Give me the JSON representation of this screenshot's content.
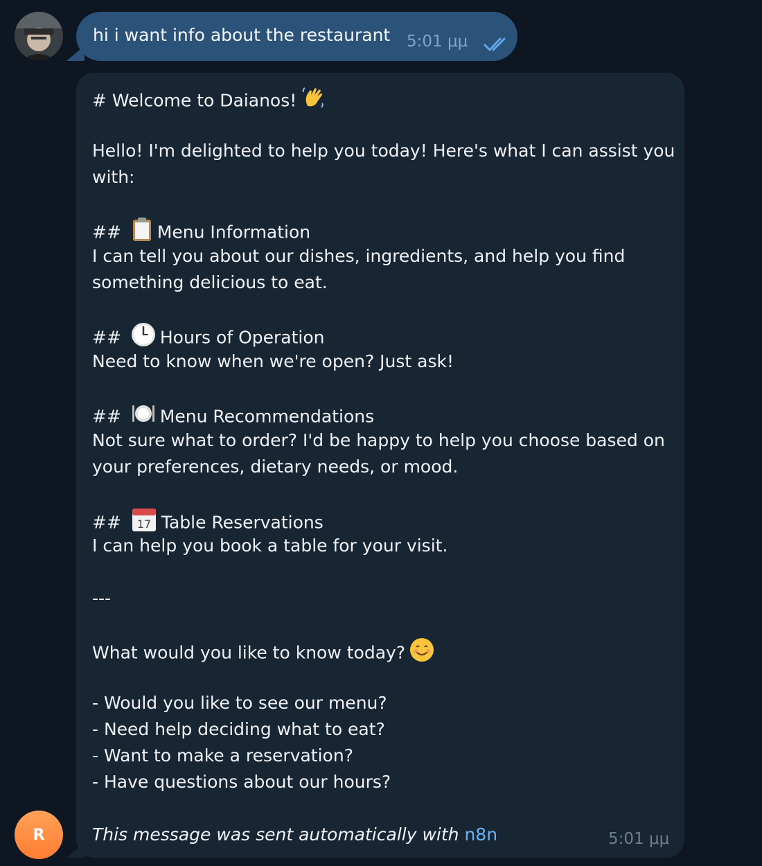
{
  "chat": {
    "outgoing": {
      "text": "hi i want info about the restaurant",
      "time": "5:01 μμ"
    },
    "incoming": {
      "lines": [
        "# Welcome to Daianos!",
        "Hello! I'm delighted to help you today! Here's what I can assist you",
        "with:",
        "## ",
        "Menu Information",
        "I can tell you about our dishes, ingredients, and help you find",
        "something delicious to eat.",
        "## ",
        "Hours of Operation",
        "Need to know when we're open? Just ask!",
        "## ",
        "Menu Recommendations",
        "Not sure what to order? I'd be happy to help you choose based on",
        "your preferences, dietary needs, or mood.",
        "## ",
        "Table Reservations",
        "I can help you book a table for your visit.",
        "---",
        "What would you like to know today?",
        "- Would you like to see our menu?",
        "- Need help deciding what to eat?",
        "- Want to make a reservation?",
        "- Have questions about our hours?"
      ],
      "signature_text": "This message was sent automatically with ",
      "signature_link": "n8n",
      "time": "5:01 μμ"
    },
    "bot_avatar_letter": "R"
  },
  "icons": {
    "wave": "waving-hand-emoji",
    "clipboard": "clipboard-emoji",
    "clock": "clock-emoji",
    "plate": "fork-knife-plate-emoji",
    "calendar": "calendar-emoji",
    "smile": "smiling-face-emoji",
    "read_receipt": "double-check-icon"
  },
  "colors": {
    "background": "#0e1621",
    "outgoing_bubble": "#2b5278",
    "incoming_bubble": "#182533",
    "link": "#6ab3f3",
    "bot_avatar": "#ff8a3d"
  }
}
